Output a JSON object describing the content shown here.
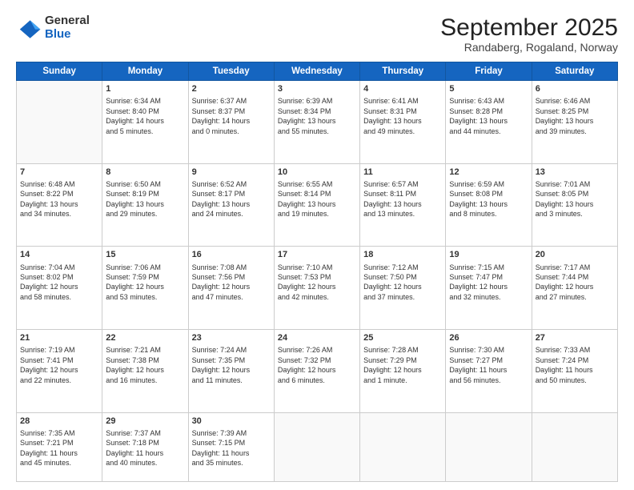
{
  "header": {
    "logo_general": "General",
    "logo_blue": "Blue",
    "title": "September 2025",
    "subtitle": "Randaberg, Rogaland, Norway"
  },
  "days_of_week": [
    "Sunday",
    "Monday",
    "Tuesday",
    "Wednesday",
    "Thursday",
    "Friday",
    "Saturday"
  ],
  "weeks": [
    [
      {
        "day": "",
        "lines": []
      },
      {
        "day": "1",
        "lines": [
          "Sunrise: 6:34 AM",
          "Sunset: 8:40 PM",
          "Daylight: 14 hours",
          "and 5 minutes."
        ]
      },
      {
        "day": "2",
        "lines": [
          "Sunrise: 6:37 AM",
          "Sunset: 8:37 PM",
          "Daylight: 14 hours",
          "and 0 minutes."
        ]
      },
      {
        "day": "3",
        "lines": [
          "Sunrise: 6:39 AM",
          "Sunset: 8:34 PM",
          "Daylight: 13 hours",
          "and 55 minutes."
        ]
      },
      {
        "day": "4",
        "lines": [
          "Sunrise: 6:41 AM",
          "Sunset: 8:31 PM",
          "Daylight: 13 hours",
          "and 49 minutes."
        ]
      },
      {
        "day": "5",
        "lines": [
          "Sunrise: 6:43 AM",
          "Sunset: 8:28 PM",
          "Daylight: 13 hours",
          "and 44 minutes."
        ]
      },
      {
        "day": "6",
        "lines": [
          "Sunrise: 6:46 AM",
          "Sunset: 8:25 PM",
          "Daylight: 13 hours",
          "and 39 minutes."
        ]
      }
    ],
    [
      {
        "day": "7",
        "lines": [
          "Sunrise: 6:48 AM",
          "Sunset: 8:22 PM",
          "Daylight: 13 hours",
          "and 34 minutes."
        ]
      },
      {
        "day": "8",
        "lines": [
          "Sunrise: 6:50 AM",
          "Sunset: 8:19 PM",
          "Daylight: 13 hours",
          "and 29 minutes."
        ]
      },
      {
        "day": "9",
        "lines": [
          "Sunrise: 6:52 AM",
          "Sunset: 8:17 PM",
          "Daylight: 13 hours",
          "and 24 minutes."
        ]
      },
      {
        "day": "10",
        "lines": [
          "Sunrise: 6:55 AM",
          "Sunset: 8:14 PM",
          "Daylight: 13 hours",
          "and 19 minutes."
        ]
      },
      {
        "day": "11",
        "lines": [
          "Sunrise: 6:57 AM",
          "Sunset: 8:11 PM",
          "Daylight: 13 hours",
          "and 13 minutes."
        ]
      },
      {
        "day": "12",
        "lines": [
          "Sunrise: 6:59 AM",
          "Sunset: 8:08 PM",
          "Daylight: 13 hours",
          "and 8 minutes."
        ]
      },
      {
        "day": "13",
        "lines": [
          "Sunrise: 7:01 AM",
          "Sunset: 8:05 PM",
          "Daylight: 13 hours",
          "and 3 minutes."
        ]
      }
    ],
    [
      {
        "day": "14",
        "lines": [
          "Sunrise: 7:04 AM",
          "Sunset: 8:02 PM",
          "Daylight: 12 hours",
          "and 58 minutes."
        ]
      },
      {
        "day": "15",
        "lines": [
          "Sunrise: 7:06 AM",
          "Sunset: 7:59 PM",
          "Daylight: 12 hours",
          "and 53 minutes."
        ]
      },
      {
        "day": "16",
        "lines": [
          "Sunrise: 7:08 AM",
          "Sunset: 7:56 PM",
          "Daylight: 12 hours",
          "and 47 minutes."
        ]
      },
      {
        "day": "17",
        "lines": [
          "Sunrise: 7:10 AM",
          "Sunset: 7:53 PM",
          "Daylight: 12 hours",
          "and 42 minutes."
        ]
      },
      {
        "day": "18",
        "lines": [
          "Sunrise: 7:12 AM",
          "Sunset: 7:50 PM",
          "Daylight: 12 hours",
          "and 37 minutes."
        ]
      },
      {
        "day": "19",
        "lines": [
          "Sunrise: 7:15 AM",
          "Sunset: 7:47 PM",
          "Daylight: 12 hours",
          "and 32 minutes."
        ]
      },
      {
        "day": "20",
        "lines": [
          "Sunrise: 7:17 AM",
          "Sunset: 7:44 PM",
          "Daylight: 12 hours",
          "and 27 minutes."
        ]
      }
    ],
    [
      {
        "day": "21",
        "lines": [
          "Sunrise: 7:19 AM",
          "Sunset: 7:41 PM",
          "Daylight: 12 hours",
          "and 22 minutes."
        ]
      },
      {
        "day": "22",
        "lines": [
          "Sunrise: 7:21 AM",
          "Sunset: 7:38 PM",
          "Daylight: 12 hours",
          "and 16 minutes."
        ]
      },
      {
        "day": "23",
        "lines": [
          "Sunrise: 7:24 AM",
          "Sunset: 7:35 PM",
          "Daylight: 12 hours",
          "and 11 minutes."
        ]
      },
      {
        "day": "24",
        "lines": [
          "Sunrise: 7:26 AM",
          "Sunset: 7:32 PM",
          "Daylight: 12 hours",
          "and 6 minutes."
        ]
      },
      {
        "day": "25",
        "lines": [
          "Sunrise: 7:28 AM",
          "Sunset: 7:29 PM",
          "Daylight: 12 hours",
          "and 1 minute."
        ]
      },
      {
        "day": "26",
        "lines": [
          "Sunrise: 7:30 AM",
          "Sunset: 7:27 PM",
          "Daylight: 11 hours",
          "and 56 minutes."
        ]
      },
      {
        "day": "27",
        "lines": [
          "Sunrise: 7:33 AM",
          "Sunset: 7:24 PM",
          "Daylight: 11 hours",
          "and 50 minutes."
        ]
      }
    ],
    [
      {
        "day": "28",
        "lines": [
          "Sunrise: 7:35 AM",
          "Sunset: 7:21 PM",
          "Daylight: 11 hours",
          "and 45 minutes."
        ]
      },
      {
        "day": "29",
        "lines": [
          "Sunrise: 7:37 AM",
          "Sunset: 7:18 PM",
          "Daylight: 11 hours",
          "and 40 minutes."
        ]
      },
      {
        "day": "30",
        "lines": [
          "Sunrise: 7:39 AM",
          "Sunset: 7:15 PM",
          "Daylight: 11 hours",
          "and 35 minutes."
        ]
      },
      {
        "day": "",
        "lines": []
      },
      {
        "day": "",
        "lines": []
      },
      {
        "day": "",
        "lines": []
      },
      {
        "day": "",
        "lines": []
      }
    ]
  ]
}
